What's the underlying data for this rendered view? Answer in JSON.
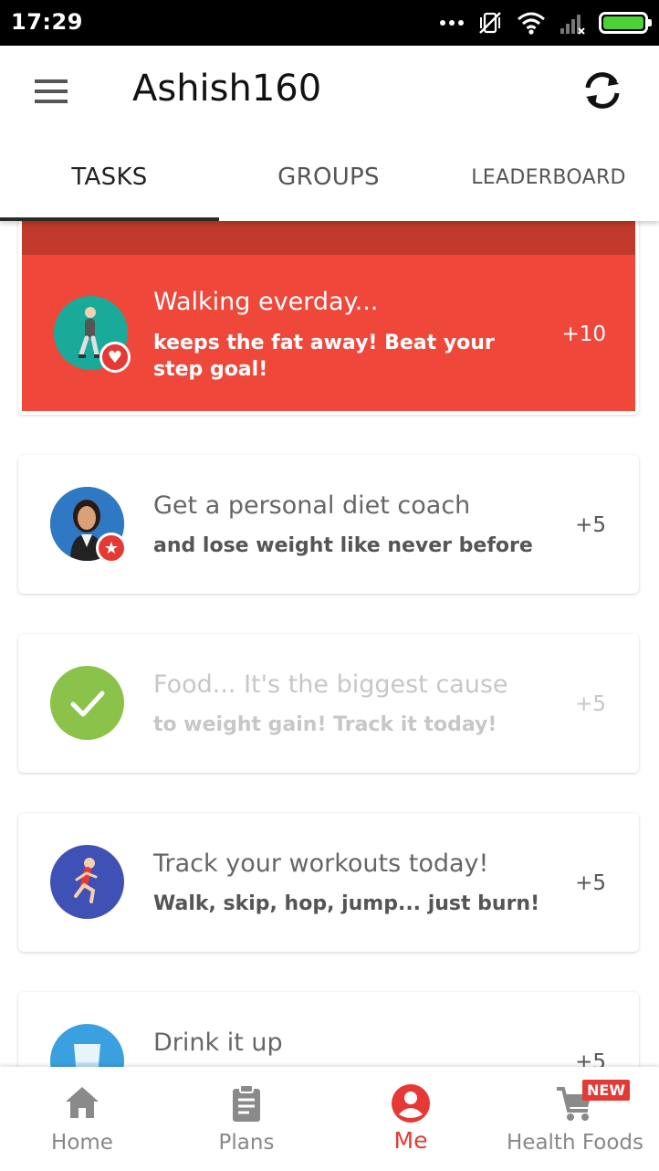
{
  "status_bar": {
    "time": "17:29",
    "battery_color": "#4cd137"
  },
  "app_bar": {
    "title": "Ashish160",
    "menu_icon": "menu-icon",
    "sync_icon": "sync-icon"
  },
  "tabs": [
    {
      "label": "TASKS",
      "active": true
    },
    {
      "label": "GROUPS",
      "active": false
    },
    {
      "label": "LEADERBOARD",
      "active": false
    }
  ],
  "tasks": [
    {
      "title": "Walking everday...",
      "subtitle": "keeps the fat away! Beat your step goal!",
      "points": "+10",
      "icon": "walking-icon",
      "badge": "heart-icon",
      "highlighted": true,
      "done": false
    },
    {
      "title": "Get a personal diet coach",
      "subtitle": "and lose weight like never before",
      "points": "+5",
      "icon": "coach-avatar",
      "badge": "star-icon",
      "highlighted": false,
      "done": false
    },
    {
      "title": "Food... It's the biggest cause",
      "subtitle": "to weight gain! Track it today!",
      "points": "+5",
      "icon": "check-icon",
      "badge": "",
      "highlighted": false,
      "done": true
    },
    {
      "title": "Track your workouts today!",
      "subtitle": "Walk, skip, hop, jump... just burn!",
      "points": "+5",
      "icon": "runner-icon",
      "badge": "",
      "highlighted": false,
      "done": false
    },
    {
      "title": "Drink it up",
      "subtitle": "",
      "points": "+5",
      "icon": "water-glass-icon",
      "badge": "",
      "highlighted": false,
      "done": false
    }
  ],
  "bottom_nav": [
    {
      "label": "Home",
      "icon": "home-icon",
      "active": false
    },
    {
      "label": "Plans",
      "icon": "clipboard-icon",
      "active": false
    },
    {
      "label": "Me",
      "icon": "profile-icon",
      "active": true
    },
    {
      "label": "Health Foods",
      "icon": "cart-icon",
      "active": false,
      "badge": "NEW"
    }
  ],
  "colors": {
    "accent": "#e53935",
    "highlight_card": "#ef473a",
    "highlight_band": "#c0392b",
    "check_green": "#8bc34a",
    "walking_teal": "#1aaa9a",
    "runner_blue": "#3f51b5",
    "water_blue": "#3aa0e0"
  }
}
